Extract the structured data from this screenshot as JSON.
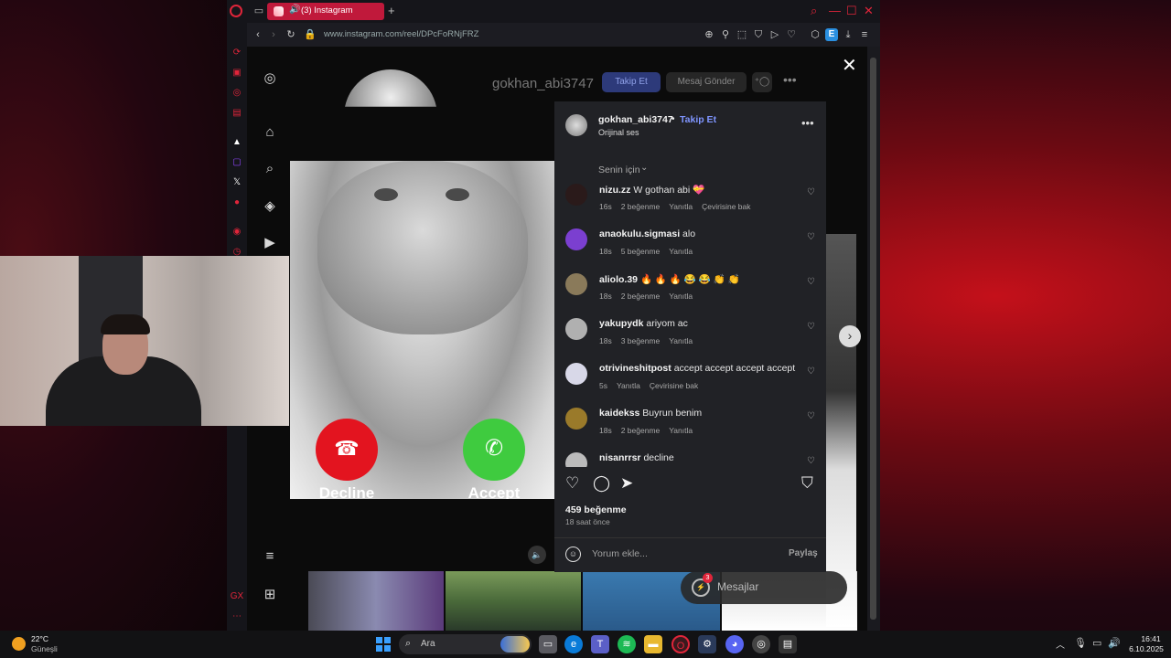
{
  "browser": {
    "tab_title": "(3) Instagram",
    "url": "www.instagram.com/reel/DPcFoRNjFRZ",
    "extension_badge": "E"
  },
  "profile_header": {
    "username": "gokhan_abi3747",
    "follow_label": "Takip Et",
    "message_label": "Mesaj Gönder"
  },
  "video": {
    "decline_label": "Decline",
    "accept_label": "Accept"
  },
  "post": {
    "username": "gokhan_abi3747",
    "separator": "•",
    "follow_label": "Takip Et",
    "audio": "Orijinal ses",
    "sort_label": "Senin için",
    "likes": "459 beğenme",
    "time_ago": "18 saat önce",
    "comment_placeholder": "Yorum ekle...",
    "post_label": "Paylaş"
  },
  "comments": [
    {
      "user": "nizu.zz",
      "text": "W gothan abi 💝",
      "time": "16s",
      "likes": "2 beğenme",
      "reply": "Yanıtla",
      "translate": "Çevirisine bak",
      "avatar_color": "#2a1a1a"
    },
    {
      "user": "anaokulu.sigmasi",
      "text": "alo",
      "time": "18s",
      "likes": "5 beğenme",
      "reply": "Yanıtla",
      "translate": "",
      "avatar_color": "#7b3fd0"
    },
    {
      "user": "aliolo.39",
      "text": "🔥 🔥 🔥 😂 😂 👏 👏",
      "time": "18s",
      "likes": "2 beğenme",
      "reply": "Yanıtla",
      "translate": "",
      "avatar_color": "#8a7a5a"
    },
    {
      "user": "yakupydk",
      "text": "ariyom ac",
      "time": "18s",
      "likes": "3 beğenme",
      "reply": "Yanıtla",
      "translate": "",
      "avatar_color": "#b0b0b0"
    },
    {
      "user": "otrivineshitpost",
      "text": "accept accept accept accept",
      "time": "5s",
      "likes": "",
      "reply": "Yanıtla",
      "translate": "Çevirisine bak",
      "avatar_color": "#d8d8e8"
    },
    {
      "user": "kaidekss",
      "text": "Buyrun benim",
      "time": "18s",
      "likes": "2 beğenme",
      "reply": "Yanıtla",
      "translate": "",
      "avatar_color": "#9a7a2a"
    },
    {
      "user": "nisanrrsr",
      "text": "decline",
      "time": "",
      "likes": "",
      "reply": "",
      "translate": "",
      "avatar_color": "#bbbbbb"
    }
  ],
  "overlay": {
    "messages_label": "Mesajlar",
    "messages_badge": "3"
  },
  "taskbar": {
    "weather_temp": "22°C",
    "weather_desc": "Güneşli",
    "search_label": "Ara",
    "time": "16:41",
    "date": "6.10.2025"
  },
  "colors": {
    "accent_red": "#e0253a",
    "follow_blue": "#7f95ff",
    "decline_red": "#e3141f",
    "accept_green": "#3fcb3f"
  }
}
